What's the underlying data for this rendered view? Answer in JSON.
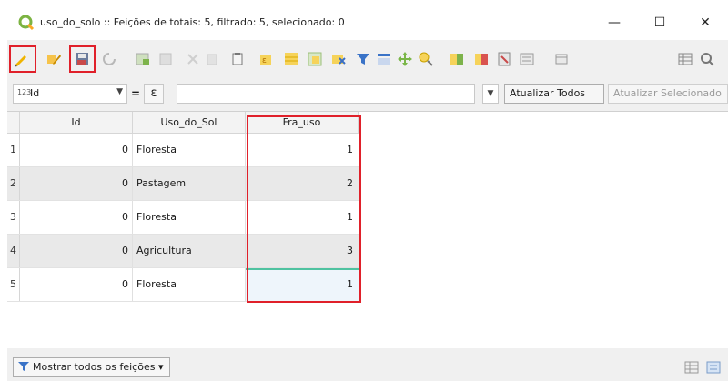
{
  "window": {
    "title": "uso_do_solo :: Feições de totais: 5, filtrado: 5, selecionado: 0",
    "minimize": "—",
    "maximize": "☐",
    "close": "✕"
  },
  "filter": {
    "field_type": "123",
    "field_name": "Id",
    "operator": "=",
    "expression_symbol": "ε",
    "value": "",
    "update_all_label": "Atualizar Todos",
    "update_selected_label": "Atualizar Selecionado"
  },
  "table": {
    "columns": [
      "Id",
      "Uso_do_Sol",
      "Fra_uso"
    ],
    "rows": [
      {
        "num": "1",
        "id": "0",
        "uso": "Floresta",
        "fra": "1"
      },
      {
        "num": "2",
        "id": "0",
        "uso": "Pastagem",
        "fra": "2"
      },
      {
        "num": "3",
        "id": "0",
        "uso": "Floresta",
        "fra": "1"
      },
      {
        "num": "4",
        "id": "0",
        "uso": "Agricultura",
        "fra": "3"
      },
      {
        "num": "5",
        "id": "0",
        "uso": "Floresta",
        "fra": "1"
      }
    ]
  },
  "status": {
    "show_all_label": "Mostrar todos os feições"
  },
  "colors": {
    "highlight": "#e0202a",
    "edit_cell": "#4fc2a0"
  },
  "icons": [
    "qgis-icon",
    "edit-pencil-icon",
    "multi-edit-icon",
    "save-edits-icon",
    "reload-icon",
    "add-feature-icon",
    "delete-feature-icon",
    "cut-icon",
    "copy-icon",
    "paste-icon",
    "select-expression-icon",
    "select-all-icon",
    "invert-selection-icon",
    "deselect-icon",
    "filter-selected-icon",
    "move-top-icon",
    "pan-icon",
    "zoom-icon",
    "new-field-icon",
    "delete-field-icon",
    "field-calculator-icon",
    "conditional-format-icon",
    "dock-icon",
    "table-view-icon",
    "form-view-icon",
    "filter-icon",
    "table-view-toggle-icon",
    "form-view-toggle-icon"
  ]
}
